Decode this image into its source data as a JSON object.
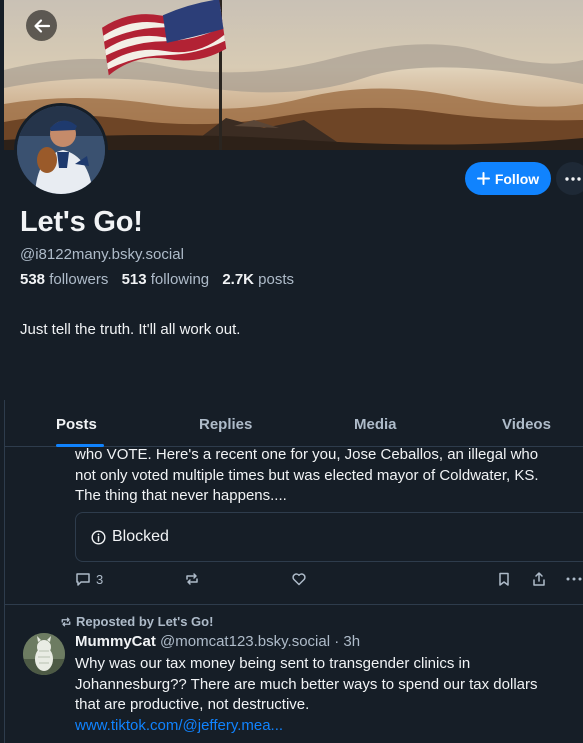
{
  "profile": {
    "display_name": "Let's Go!",
    "handle": "@i8122many.bsky.social",
    "followers_count": "538",
    "followers_label": "followers",
    "following_count": "513",
    "following_label": "following",
    "posts_count": "2.7K",
    "posts_label": "posts",
    "bio": "Just tell the truth. It'll all work out.",
    "follow_label": "Follow"
  },
  "tabs": [
    {
      "label": "Posts",
      "active": true
    },
    {
      "label": "Replies",
      "active": false
    },
    {
      "label": "Media",
      "active": false
    },
    {
      "label": "Videos",
      "active": false
    }
  ],
  "posts": [
    {
      "text_lines": [
        "who VOTE.  Here's a recent one for you, Jose Ceballos, an illegal who",
        "not only voted multiple times but was elected mayor of Coldwater, KS.",
        "The thing that never happens...."
      ],
      "embed_label": "Blocked",
      "reply_count": "3"
    },
    {
      "repost_label": "Reposted by Let's Go!",
      "author_name": "MummyCat",
      "author_handle": "@momcat123.bsky.social",
      "time": "3h",
      "text_lines": [
        "Why was our tax money being sent to transgender clinics in",
        "Johannesburg??   There are much better ways to spend our tax dollars",
        "that are productive, not destructive."
      ],
      "link": "www.tiktok.com/@jeffery.mea..."
    }
  ],
  "colors": {
    "background": "#161e27",
    "accent": "#1083fe",
    "muted_text": "#aebbc9",
    "border": "#2e3c4c"
  },
  "icons": {
    "back": "arrow-left-icon",
    "follow": "plus-icon",
    "more": "ellipsis-icon",
    "blocked": "info-circle-icon",
    "reply": "speech-bubble-icon",
    "repost": "repost-arrows-icon",
    "like": "heart-icon",
    "bookmark": "bookmark-icon",
    "share": "share-icon"
  }
}
